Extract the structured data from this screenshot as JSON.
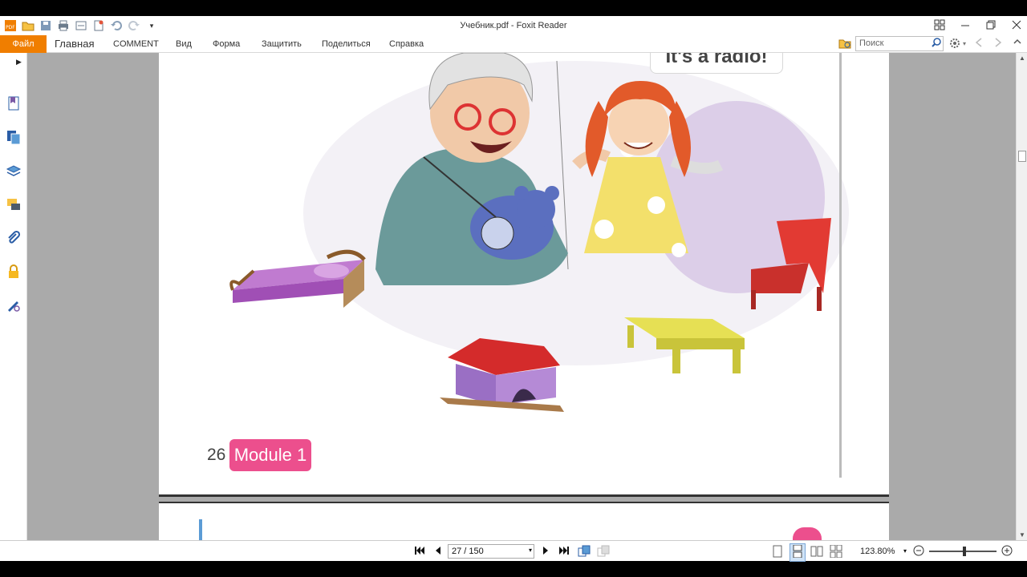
{
  "window": {
    "title": "Учебник.pdf - Foxit Reader"
  },
  "ribbon": {
    "tabs": [
      "Файл",
      "Главная",
      "COMMENT",
      "Вид",
      "Форма",
      "Защитить",
      "Поделиться",
      "Справка"
    ],
    "search_placeholder": "Поиск"
  },
  "document": {
    "speech_bubble": "It's a radio!",
    "page_number": "26",
    "module_label": "Module 1"
  },
  "statusbar": {
    "page_indicator": "27 / 150",
    "zoom": "123.80%"
  },
  "colors": {
    "accent": "#f07e00",
    "module_pink": "#ec4f8d"
  }
}
